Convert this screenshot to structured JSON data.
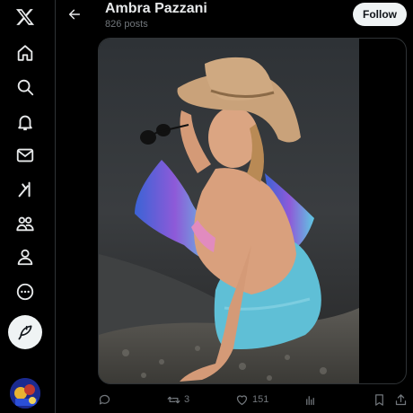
{
  "header": {
    "name": "Ambra Pazzani",
    "posts": "826 posts",
    "follow_label": "Follow"
  },
  "nav": {
    "items": [
      {
        "icon": "x-logo-icon"
      },
      {
        "icon": "home-icon"
      },
      {
        "icon": "search-icon"
      },
      {
        "icon": "notifications-bell-icon"
      },
      {
        "icon": "messages-envelope-icon"
      },
      {
        "icon": "grok-icon"
      },
      {
        "icon": "communities-icon"
      },
      {
        "icon": "profile-icon"
      },
      {
        "icon": "more-circle-icon"
      }
    ],
    "compose_icon": "compose-feather-icon"
  },
  "actions": {
    "reply_count": "",
    "retweet_count": "3",
    "like_count": "151",
    "views_count": ""
  },
  "colors": {
    "background": "#000000",
    "text": "#e7e9ea",
    "muted": "#71767b",
    "border": "#2f3336",
    "button_bg": "#eff3f4"
  }
}
